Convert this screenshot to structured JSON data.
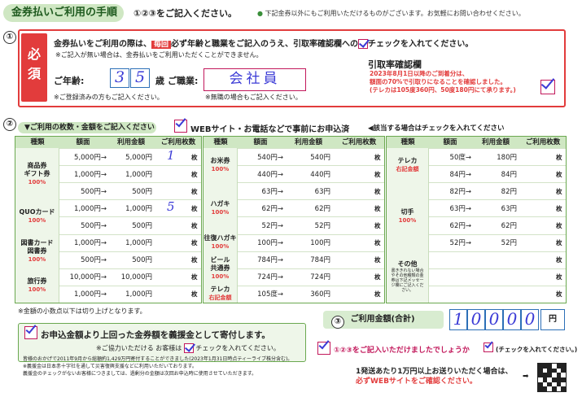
{
  "header": {
    "title": "金券払いご利用の手順",
    "instruction": "①②③をご記入ください。",
    "note": "下記金券以外にもご利用いただけるものがございます。お気軽にお問い合わせください。"
  },
  "section1": {
    "num": "①",
    "hissu": "必須",
    "line1_a": "金券払いをご利用の際は、",
    "line1_badge": "毎回",
    "line1_b": "必ず年齢と職業をご記入のうえ、引取率確認欄への",
    "line1_c": "チェックを入れてください。",
    "line2": "※ご記入が無い場合は、金券払いをご利用いただくことができません。",
    "age_label": "ご年齢:",
    "age_digits": [
      "3",
      "5"
    ],
    "age_unit": "歳",
    "age_note": "※ご登録済みの方もご記入ください。",
    "job_label": "ご職業:",
    "job_value": "会社員",
    "job_note": "※無職の場合もご記入ください。",
    "rate_title": "引取率確認欄",
    "rate_text": [
      "2023年8月1日以降のご到着分は、",
      "額面の70%で引取りになることを確認しました。",
      "(テレカは105度360円、50度180円にて承ります。)"
    ]
  },
  "section2": {
    "num": "②",
    "title": "▼ご利用の枚数・金額をご記入ください",
    "web_label": "WEBサイト・お電話などで事前にお申込済",
    "web_note": "◀該当する場合はチェックを入れてください",
    "headers": [
      "種類",
      "額面",
      "利用金額",
      "ご利用枚数"
    ],
    "mai": "枚",
    "table1": {
      "categories": [
        {
          "name": "商品券\nギフト券",
          "pct": "100%",
          "rows": 3
        },
        {
          "name": "QUOカード",
          "pct": "100%",
          "rows": 2
        },
        {
          "name": "図書カード\n図書券",
          "pct": "100%",
          "rows": 2
        },
        {
          "name": "旅行券",
          "pct": "100%",
          "rows": 2
        }
      ],
      "rows": [
        {
          "face": "5,000円→",
          "use": "5,000円",
          "qty": "1"
        },
        {
          "face": "1,000円→",
          "use": "1,000円",
          "qty": ""
        },
        {
          "face": "500円→",
          "use": "500円",
          "qty": ""
        },
        {
          "face": "1,000円→",
          "use": "1,000円",
          "qty": "5"
        },
        {
          "face": "500円→",
          "use": "500円",
          "qty": ""
        },
        {
          "face": "1,000円→",
          "use": "1,000円",
          "qty": ""
        },
        {
          "face": "500円→",
          "use": "500円",
          "qty": ""
        },
        {
          "face": "10,000円→",
          "use": "10,000円",
          "qty": ""
        },
        {
          "face": "1,000円→",
          "use": "1,000円",
          "qty": ""
        }
      ]
    },
    "table2": {
      "categories": [
        {
          "name": "お米券",
          "pct": "100%",
          "rows": 2
        },
        {
          "name": "ハガキ",
          "pct": "100%",
          "rows": 3
        },
        {
          "name": "往復ハガキ",
          "pct": "100%",
          "rows": 1
        },
        {
          "name": "ビール\n共通券",
          "pct": "100%",
          "rows": 2
        },
        {
          "name": "テレカ",
          "pct": "右記金額",
          "rows": 1
        }
      ],
      "rows": [
        {
          "face": "540円→",
          "use": "540円"
        },
        {
          "face": "440円→",
          "use": "440円"
        },
        {
          "face": "63円→",
          "use": "63円"
        },
        {
          "face": "62円→",
          "use": "62円"
        },
        {
          "face": "52円→",
          "use": "52円"
        },
        {
          "face": "100円→",
          "use": "100円"
        },
        {
          "face": "784円→",
          "use": "784円"
        },
        {
          "face": "724円→",
          "use": "724円"
        },
        {
          "face": "105度→",
          "use": "360円"
        }
      ]
    },
    "table3": {
      "categories": [
        {
          "name": "テレカ",
          "pct": "右記金額",
          "rows": 2
        },
        {
          "name": "切手",
          "pct": "100%",
          "rows": 4
        },
        {
          "name": "その他",
          "pct": "",
          "sub": "書ききれない場合やその他種類の金券は下記メッセージ欄にご記入ください。",
          "rows": 3
        }
      ],
      "rows": [
        {
          "face": "50度→",
          "use": "180円"
        },
        {
          "face": "84円→",
          "use": "84円"
        },
        {
          "face": "82円→",
          "use": "82円"
        },
        {
          "face": "63円→",
          "use": "63円"
        },
        {
          "face": "62円→",
          "use": "62円"
        },
        {
          "face": "52円→",
          "use": "52円"
        },
        {
          "face": "",
          "use": ""
        },
        {
          "face": "",
          "use": ""
        },
        {
          "face": "",
          "use": ""
        }
      ]
    },
    "footnote": "※金額の小数点以下は切り上げとなります。"
  },
  "section3": {
    "num": "③",
    "label": "ご利用金額(合計)",
    "digits": [
      "1",
      "0",
      "0",
      "0",
      "0"
    ],
    "unit": "円",
    "confirm": "①②③をご記入いただけましたでしょうか",
    "confirm_note": "(チェックを入れてください。)"
  },
  "donation": {
    "title": "お申込金額より上回った金券額を義援金として寄付します。",
    "sub": "※ご協力いただける お客様は",
    "sub2": "チェックを入れてください。",
    "fine1": "皆様のおかげで2011年9月から総額約1,429万円寄付することができました(2023年1月31日時点ティーライブ株分含む)。",
    "fine2": "※義援金は日本赤十字社を通して災害復興支援などに利用いただいております。",
    "fine3": "義援金のチェックがないお客様につきましては、過剰分の金額は次回お申込時に使用させていただきます。"
  },
  "bottom": {
    "line1": "1発送あたり1万円以上お送りいただく場合は、",
    "line2": "必ずWEBサイトをご確認ください。"
  },
  "colors": {
    "accent_red": "#e23c3c",
    "green": "#6aa84f",
    "pen_blue": "#3b3bd6"
  }
}
